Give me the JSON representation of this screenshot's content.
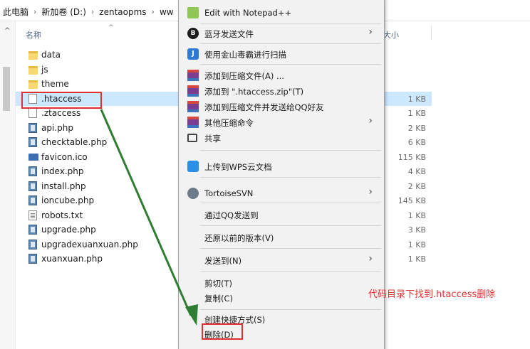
{
  "breadcrumb": [
    "此电脑",
    "新加卷 (D:)",
    "zentaopms",
    "ww"
  ],
  "header": {
    "name": "名称",
    "size": "大小"
  },
  "files": [
    {
      "name": "data",
      "icon": "folder-icon",
      "size": ""
    },
    {
      "name": "js",
      "icon": "folder-icon",
      "size": ""
    },
    {
      "name": "theme",
      "icon": "folder-icon",
      "size": ""
    },
    {
      "name": ".htaccess",
      "icon": "file-icon",
      "size": "1 KB",
      "selected": true
    },
    {
      "name": ".ztaccess",
      "icon": "file-icon",
      "size": "1 KB"
    },
    {
      "name": "api.php",
      "icon": "php-file-icon",
      "size": "2 KB"
    },
    {
      "name": "checktable.php",
      "icon": "php-file-icon",
      "size": "6 KB"
    },
    {
      "name": "favicon.ico",
      "icon": "image-file-icon",
      "size": "115 KB"
    },
    {
      "name": "index.php",
      "icon": "php-file-icon",
      "size": "4 KB"
    },
    {
      "name": "install.php",
      "icon": "php-file-icon",
      "size": "2 KB"
    },
    {
      "name": "ioncube.php",
      "icon": "php-file-icon",
      "size": "145 KB"
    },
    {
      "name": "robots.txt",
      "icon": "text-file-icon",
      "size": "1 KB"
    },
    {
      "name": "upgrade.php",
      "icon": "php-file-icon",
      "size": "3 KB"
    },
    {
      "name": "upgradexuanxuan.php",
      "icon": "php-file-icon",
      "size": "1 KB"
    },
    {
      "name": "xuanxuan.php",
      "icon": "php-file-icon",
      "size": "1 KB"
    }
  ],
  "context_menu": {
    "items": [
      {
        "label": "Edit with Notepad++",
        "icon": "notepad-icon"
      },
      {
        "label": "蓝牙发送文件",
        "icon": "bluetooth-icon",
        "submenu": true
      },
      {
        "label": "使用金山毒霸进行扫描",
        "icon": "kingsoft-icon"
      },
      {
        "label": "添加到压缩文件(A) ...",
        "icon": "archive-icon"
      },
      {
        "label": "添加到 \".htaccess.zip\"(T)",
        "icon": "archive-icon"
      },
      {
        "label": "添加到压缩文件并发送给QQ好友",
        "icon": "archive-icon"
      },
      {
        "label": "其他压缩命令",
        "icon": "archive-icon",
        "submenu": true
      },
      {
        "label": "共享",
        "icon": "share-icon"
      },
      {
        "label": "上传到WPS云文档",
        "icon": "wps-cloud-icon"
      },
      {
        "label": "TortoiseSVN",
        "icon": "tortoisesvn-icon",
        "submenu": true
      },
      {
        "label": "通过QQ发送到"
      },
      {
        "label": "还原以前的版本(V)"
      },
      {
        "label": "发送到(N)",
        "submenu": true
      },
      {
        "label": "剪切(T)"
      },
      {
        "label": "复制(C)"
      },
      {
        "label": "创建快捷方式(S)"
      },
      {
        "label": "删除(D)"
      }
    ]
  },
  "annotation": {
    "text": "代码目录下找到.htaccess删除",
    "color": "#e0302f"
  },
  "colors": {
    "selection": "#cce8ff",
    "highlight_box": "#e03131",
    "arrow": "#2e7d32"
  }
}
